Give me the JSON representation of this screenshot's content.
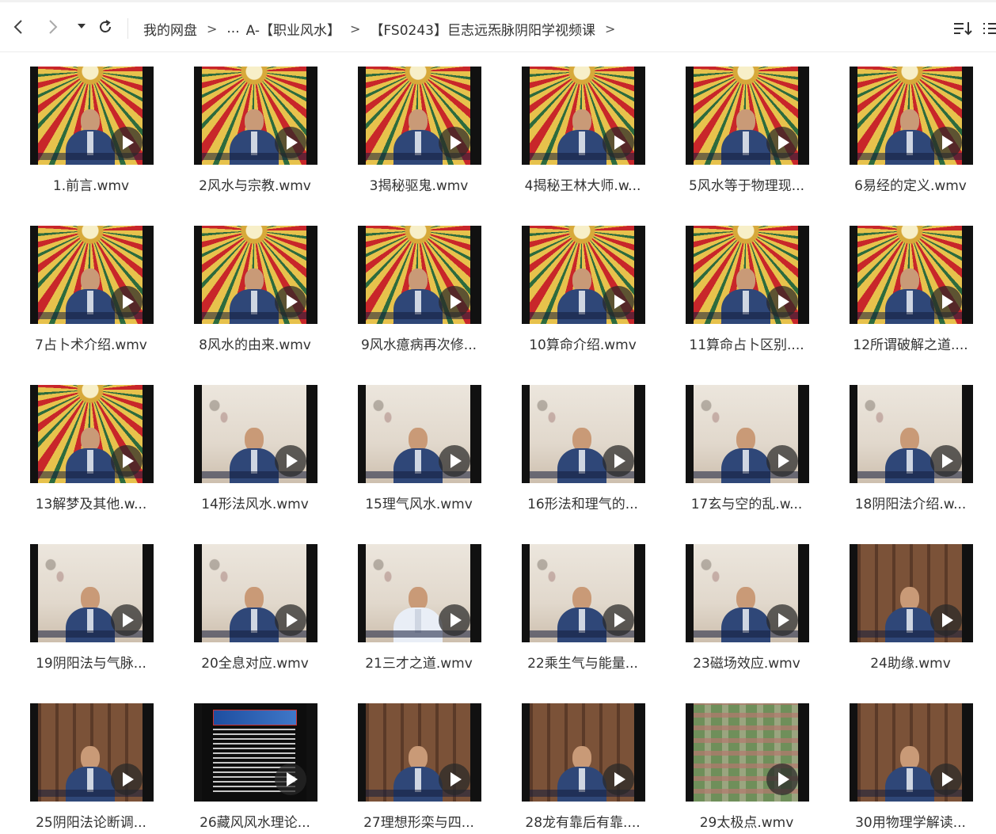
{
  "toolbar": {
    "back_icon": "chevron-left-icon",
    "forward_icon": "chevron-right-icon",
    "history_icon": "caret-down-icon",
    "refresh_icon": "refresh-icon",
    "sort_icon": "sort-icon",
    "view_icon": "list-view-icon"
  },
  "breadcrumb": {
    "root": "我的网盘",
    "sep1": ">",
    "ellipsis": "...",
    "folder1": "A-【职业风水】",
    "sep2": ">",
    "folder2": "【FS0243】巨志远炁脉阴阳学视频课",
    "sep3": ">"
  },
  "files": [
    {
      "name": "1.前言.wmv",
      "bg": "bagua",
      "person": "suit"
    },
    {
      "name": "2风水与宗教.wmv",
      "bg": "bagua",
      "person": "suit"
    },
    {
      "name": "3揭秘驱鬼.wmv",
      "bg": "bagua",
      "person": "suit"
    },
    {
      "name": "4揭秘王林大师.w...",
      "bg": "bagua",
      "person": "suit"
    },
    {
      "name": "5风水等于物理现...",
      "bg": "bagua",
      "person": "suit"
    },
    {
      "name": "6易经的定义.wmv",
      "bg": "bagua",
      "person": "suit"
    },
    {
      "name": "7占卜术介绍.wmv",
      "bg": "bagua",
      "person": "suit"
    },
    {
      "name": "8风水的由来.wmv",
      "bg": "bagua",
      "person": "suit"
    },
    {
      "name": "9风水癔病再次修...",
      "bg": "bagua",
      "person": "suit"
    },
    {
      "name": "10算命介绍.wmv",
      "bg": "bagua",
      "person": "suit"
    },
    {
      "name": "11算命占卜区别....",
      "bg": "bagua",
      "person": "suit"
    },
    {
      "name": "12所谓破解之道....",
      "bg": "bagua",
      "person": "suit"
    },
    {
      "name": "13解梦及其他.w...",
      "bg": "bagua",
      "person": "suit"
    },
    {
      "name": "14形法风水.wmv",
      "bg": "wall",
      "person": "suit"
    },
    {
      "name": "15理气风水.wmv",
      "bg": "wall",
      "person": "suit"
    },
    {
      "name": "16形法和理气的...",
      "bg": "wall",
      "person": "suit"
    },
    {
      "name": "17玄与空的乱.w...",
      "bg": "wall",
      "person": "suit"
    },
    {
      "name": "18阴阳法介绍.w...",
      "bg": "wall",
      "person": "suit"
    },
    {
      "name": "19阴阳法与气脉...",
      "bg": "wall",
      "person": "suit"
    },
    {
      "name": "20全息对应.wmv",
      "bg": "wall",
      "person": "suit"
    },
    {
      "name": "21三才之道.wmv",
      "bg": "wall",
      "person": "white"
    },
    {
      "name": "22乘生气与能量...",
      "bg": "wall",
      "person": "suit"
    },
    {
      "name": "23磁场效应.wmv",
      "bg": "wall",
      "person": "suit"
    },
    {
      "name": "24助缘.wmv",
      "bg": "room",
      "person": "suit"
    },
    {
      "name": "25阴阳法论断调...",
      "bg": "room",
      "person": "suit"
    },
    {
      "name": "26藏风风水理论...",
      "bg": "slide",
      "person": "none"
    },
    {
      "name": "27理想形栾与四...",
      "bg": "room",
      "person": "suit"
    },
    {
      "name": "28龙有靠后有靠....",
      "bg": "room",
      "person": "suit"
    },
    {
      "name": "29太极点.wmv",
      "bg": "map",
      "person": "none"
    },
    {
      "name": "30用物理学解读...",
      "bg": "room",
      "person": "suit"
    }
  ]
}
